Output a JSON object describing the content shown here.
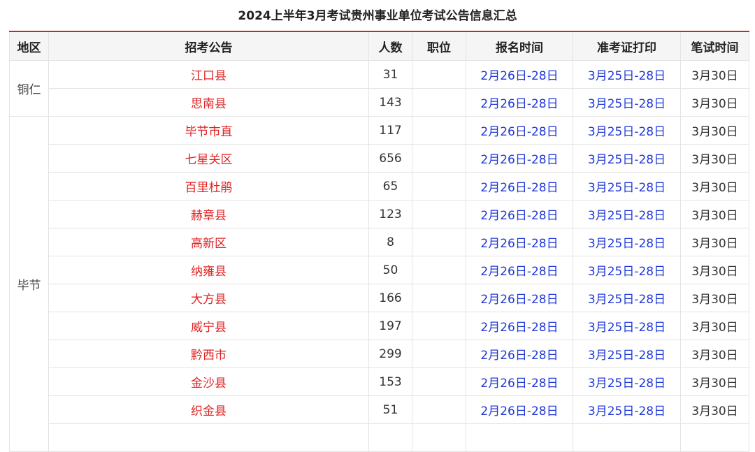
{
  "title": "2024上半年3月考试贵州事业单位考试公告信息汇总",
  "columns": [
    "地区",
    "招考公告",
    "人数",
    "职位",
    "报名时间",
    "准考证打印",
    "笔试时间"
  ],
  "groups": [
    {
      "region": "铜仁",
      "rows": [
        {
          "notice": "江口县",
          "count": "31",
          "position": "",
          "reg": "2月26日-28日",
          "ticket": "3月25日-28日",
          "exam": "3月30日"
        },
        {
          "notice": "思南县",
          "count": "143",
          "position": "",
          "reg": "2月26日-28日",
          "ticket": "3月25日-28日",
          "exam": "3月30日"
        }
      ]
    },
    {
      "region": "毕节",
      "rows": [
        {
          "notice": "毕节市直",
          "count": "117",
          "position": "",
          "reg": "2月26日-28日",
          "ticket": "3月25日-28日",
          "exam": "3月30日"
        },
        {
          "notice": "七星关区",
          "count": "656",
          "position": "",
          "reg": "2月26日-28日",
          "ticket": "3月25日-28日",
          "exam": "3月30日"
        },
        {
          "notice": "百里杜鹃",
          "count": "65",
          "position": "",
          "reg": "2月26日-28日",
          "ticket": "3月25日-28日",
          "exam": "3月30日"
        },
        {
          "notice": "赫章县",
          "count": "123",
          "position": "",
          "reg": "2月26日-28日",
          "ticket": "3月25日-28日",
          "exam": "3月30日"
        },
        {
          "notice": "高新区",
          "count": "8",
          "position": "",
          "reg": "2月26日-28日",
          "ticket": "3月25日-28日",
          "exam": "3月30日"
        },
        {
          "notice": "纳雍县",
          "count": "50",
          "position": "",
          "reg": "2月26日-28日",
          "ticket": "3月25日-28日",
          "exam": "3月30日"
        },
        {
          "notice": "大方县",
          "count": "166",
          "position": "",
          "reg": "2月26日-28日",
          "ticket": "3月25日-28日",
          "exam": "3月30日"
        },
        {
          "notice": "威宁县",
          "count": "197",
          "position": "",
          "reg": "2月26日-28日",
          "ticket": "3月25日-28日",
          "exam": "3月30日"
        },
        {
          "notice": "黔西市",
          "count": "299",
          "position": "",
          "reg": "2月26日-28日",
          "ticket": "3月25日-28日",
          "exam": "3月30日"
        },
        {
          "notice": "金沙县",
          "count": "153",
          "position": "",
          "reg": "2月26日-28日",
          "ticket": "3月25日-28日",
          "exam": "3月30日"
        },
        {
          "notice": "织金县",
          "count": "51",
          "position": "",
          "reg": "2月26日-28日",
          "ticket": "3月25日-28日",
          "exam": "3月30日"
        }
      ]
    }
  ],
  "colors": {
    "accent_red": "#d42020",
    "notice_red": "#e02222",
    "date_blue": "#1f38d8"
  }
}
